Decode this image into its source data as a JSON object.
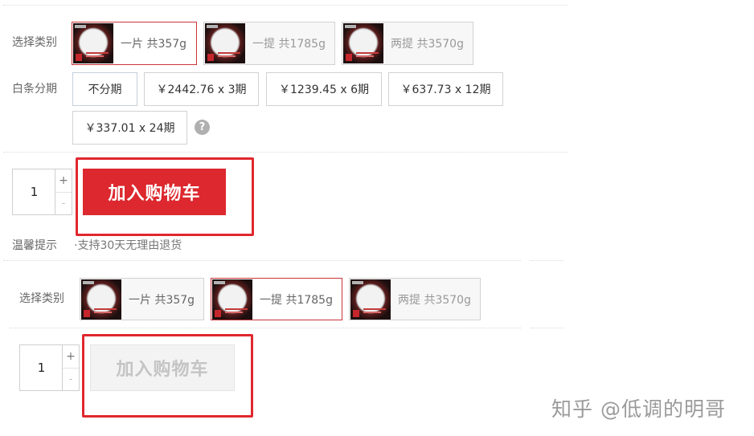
{
  "section1": {
    "category_label": "选择类别",
    "categories": [
      {
        "label": "一片 共357g",
        "selected": true
      },
      {
        "label": "一提 共1785g",
        "selected": false
      },
      {
        "label": "两提 共3570g",
        "selected": false
      }
    ],
    "installment_label": "白条分期",
    "installments": [
      "不分期",
      "￥2442.76 x 3期",
      "￥1239.45 x 6期",
      "￥637.73 x 12期",
      "￥337.01 x 24期"
    ],
    "help_glyph": "?",
    "quantity": "1",
    "qty_plus": "+",
    "qty_minus": "-",
    "add_to_cart": "加入购物车",
    "tip_label": "温馨提示",
    "tip_text": "·支持30天无理由退货"
  },
  "section2": {
    "category_label": "选择类别",
    "categories": [
      {
        "label": "一片 共357g",
        "selected": false
      },
      {
        "label": "一提 共1785g",
        "selected": true
      },
      {
        "label": "两提 共3570g",
        "selected": false
      }
    ],
    "quantity": "1",
    "qty_plus": "+",
    "qty_minus": "-",
    "add_to_cart": "加入购物车"
  },
  "watermark": "知乎 @低调的明哥",
  "colors": {
    "accent_red": "#dc282e",
    "highlight_box": "#e0272e",
    "selected_border": "#c8343a"
  }
}
